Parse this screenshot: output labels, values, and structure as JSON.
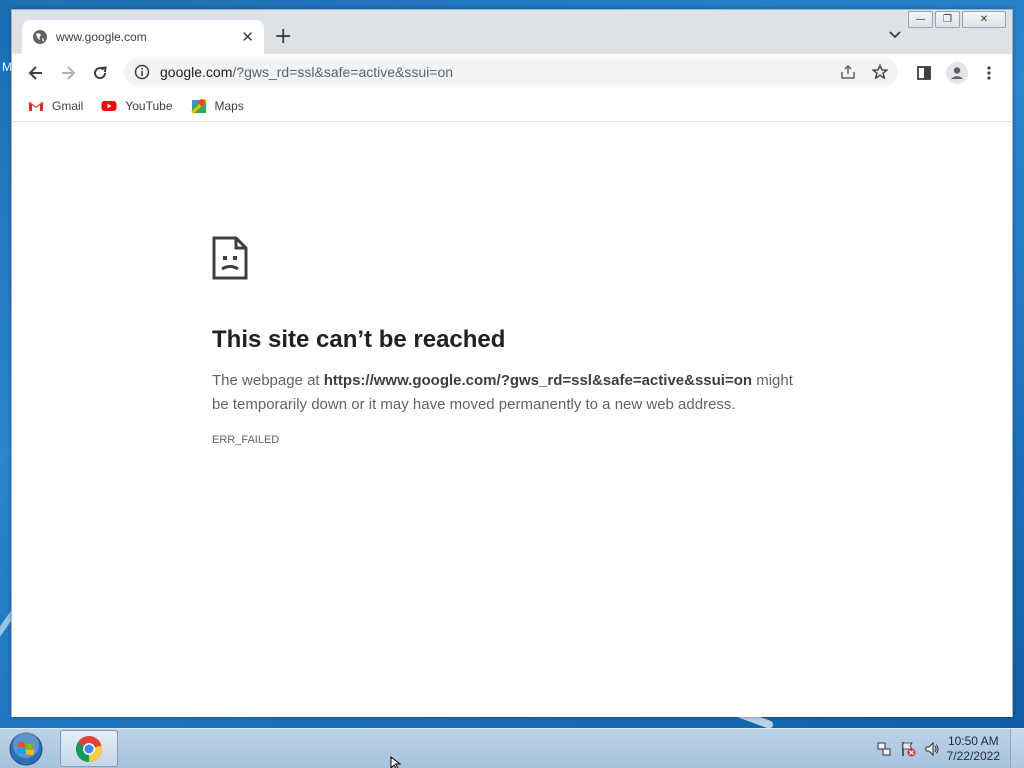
{
  "desktop": {
    "edge_letter": "M"
  },
  "browser": {
    "tab": {
      "title": "www.google.com"
    },
    "window_controls": {
      "minimize": "—",
      "restore": "❐",
      "close": "✕"
    },
    "new_tab": "+",
    "address": {
      "host": "google.com",
      "rest": "/?gws_rd=ssl&safe=active&ssui=on"
    },
    "bookmarks": [
      {
        "label": "Gmail",
        "icon": "gmail-icon"
      },
      {
        "label": "YouTube",
        "icon": "youtube-icon"
      },
      {
        "label": "Maps",
        "icon": "maps-icon"
      }
    ]
  },
  "error_page": {
    "heading": "This site can’t be reached",
    "body_prefix": "The webpage at ",
    "url": "https://www.google.com/?gws_rd=ssl&safe=active&ssui=on",
    "body_suffix": " might be temporarily down or it may have moved permanently to a new web address.",
    "code": "ERR_FAILED"
  },
  "taskbar": {
    "time": "10:50 AM",
    "date": "7/22/2022"
  }
}
